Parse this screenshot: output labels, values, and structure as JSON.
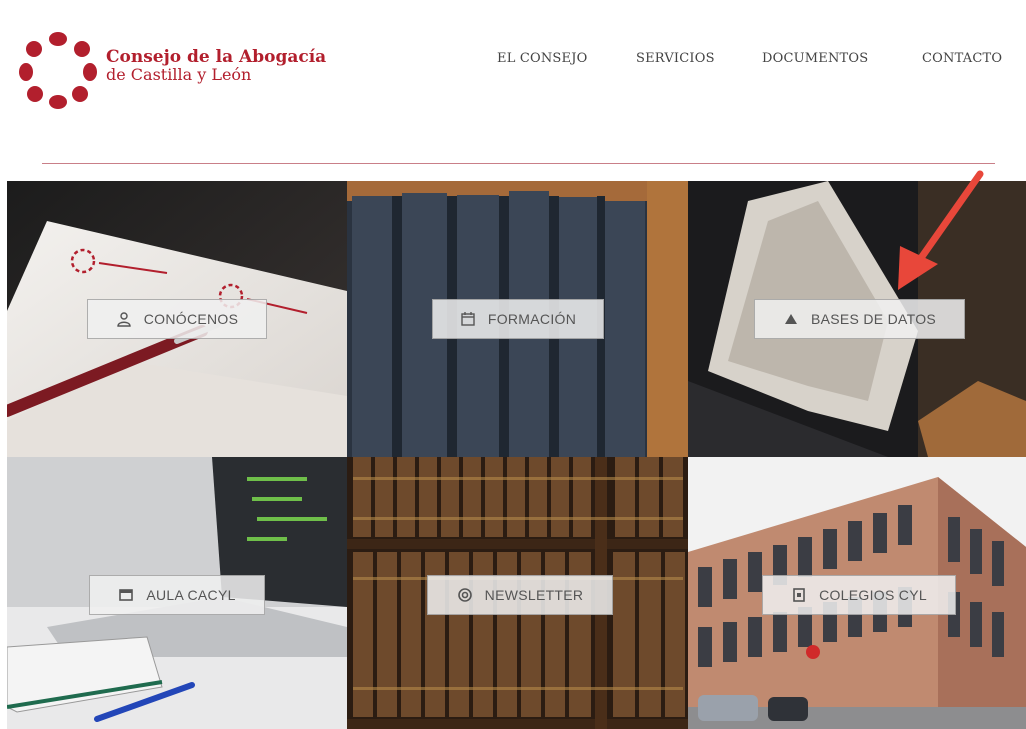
{
  "brand": {
    "line1": "Consejo de la Abogacía",
    "line2": "de Castilla y León"
  },
  "nav": [
    {
      "label": "EL CONSEJO"
    },
    {
      "label": "SERVICIOS"
    },
    {
      "label": "DOCUMENTOS"
    },
    {
      "label": "CONTACTO"
    }
  ],
  "tiles": [
    {
      "label": "CONÓCENOS",
      "icon": "user-icon"
    },
    {
      "label": "FORMACIÓN",
      "icon": "calendar-icon"
    },
    {
      "label": "BASES DE DATOS",
      "icon": "database-icon"
    },
    {
      "label": "AULA CACYL",
      "icon": "window-icon"
    },
    {
      "label": "NEWSLETTER",
      "icon": "newsletter-icon"
    },
    {
      "label": "COLEGIOS CYL",
      "icon": "building-icon"
    }
  ],
  "colors": {
    "brand_red": "#b21f2d",
    "divider": "#c97f88",
    "annotation_arrow": "#e8473a"
  }
}
